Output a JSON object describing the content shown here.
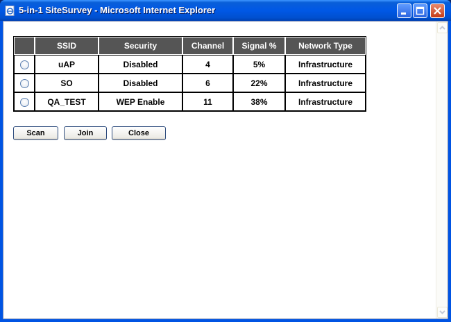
{
  "window": {
    "title": "5-in-1 SiteSurvey - Microsoft Internet Explorer",
    "colors": {
      "titlebar": "#0054e3",
      "table_header": "#555555",
      "close_button": "#c53a16"
    }
  },
  "table": {
    "headers": [
      "SSID",
      "Security",
      "Channel",
      "Signal %",
      "Network Type"
    ],
    "rows": [
      {
        "ssid": "uAP",
        "security": "Disabled",
        "channel": "4",
        "signal": "5%",
        "network_type": "Infrastructure"
      },
      {
        "ssid": "SO",
        "security": "Disabled",
        "channel": "6",
        "signal": "22%",
        "network_type": "Infrastructure"
      },
      {
        "ssid": "QA_TEST",
        "security": "WEP Enable",
        "channel": "11",
        "signal": "38%",
        "network_type": "Infrastructure"
      }
    ]
  },
  "buttons": {
    "scan": "Scan",
    "join": "Join",
    "close": "Close"
  }
}
